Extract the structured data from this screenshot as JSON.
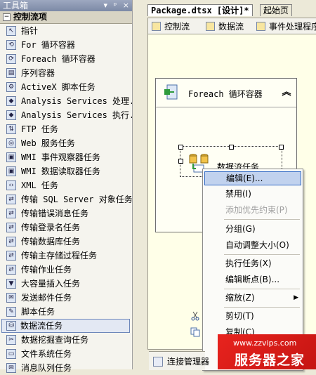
{
  "toolbox": {
    "title": "工具箱",
    "title_buttons": [
      "▾",
      "ᵖ",
      "×"
    ],
    "section": "控制流项",
    "section_toggle": "−",
    "items": [
      {
        "label": "指针",
        "icon": "pointer-icon",
        "glyph": "↖"
      },
      {
        "label": "For 循环容器",
        "icon": "for-loop-icon",
        "glyph": "⟲"
      },
      {
        "label": "Foreach 循环容器",
        "icon": "foreach-loop-icon",
        "glyph": "⟳"
      },
      {
        "label": "序列容器",
        "icon": "sequence-container-icon",
        "glyph": "▤"
      },
      {
        "label": "ActiveX 脚本任务",
        "icon": "activex-script-icon",
        "glyph": "⚙"
      },
      {
        "label": "Analysis Services 处理...",
        "icon": "analysis-processing-icon",
        "glyph": "◆"
      },
      {
        "label": "Analysis Services 执行...",
        "icon": "analysis-execute-icon",
        "glyph": "◆"
      },
      {
        "label": "FTP 任务",
        "icon": "ftp-icon",
        "glyph": "⇅"
      },
      {
        "label": "Web 服务任务",
        "icon": "web-service-icon",
        "glyph": "◎"
      },
      {
        "label": "WMI 事件观察器任务",
        "icon": "wmi-event-icon",
        "glyph": "▣"
      },
      {
        "label": "WMI 数据读取器任务",
        "icon": "wmi-reader-icon",
        "glyph": "▣"
      },
      {
        "label": "XML 任务",
        "icon": "xml-icon",
        "glyph": "‹›"
      },
      {
        "label": "传输 SQL Server 对象任务",
        "icon": "transfer-objects-icon",
        "glyph": "⇄"
      },
      {
        "label": "传输错误消息任务",
        "icon": "transfer-errors-icon",
        "glyph": "⇄"
      },
      {
        "label": "传输登录名任务",
        "icon": "transfer-logins-icon",
        "glyph": "⇄"
      },
      {
        "label": "传输数据库任务",
        "icon": "transfer-database-icon",
        "glyph": "⇄"
      },
      {
        "label": "传输主存储过程任务",
        "icon": "transfer-procs-icon",
        "glyph": "⇄"
      },
      {
        "label": "传输作业任务",
        "icon": "transfer-jobs-icon",
        "glyph": "⇄"
      },
      {
        "label": "大容量插入任务",
        "icon": "bulk-insert-icon",
        "glyph": "▼"
      },
      {
        "label": "发送邮件任务",
        "icon": "send-mail-icon",
        "glyph": "✉"
      },
      {
        "label": "脚本任务",
        "icon": "script-icon",
        "glyph": "✎"
      },
      {
        "label": "数据流任务",
        "icon": "data-flow-icon",
        "glyph": "⛁",
        "selected": true
      },
      {
        "label": "数据挖掘查询任务",
        "icon": "data-mining-icon",
        "glyph": "✂"
      },
      {
        "label": "文件系统任务",
        "icon": "file-system-icon",
        "glyph": "▭"
      },
      {
        "label": "消息队列任务",
        "icon": "message-queue-icon",
        "glyph": "✉"
      }
    ]
  },
  "designer": {
    "doc_tabs": [
      "Package.dtsx [设计]*",
      "起始页"
    ],
    "sub_tabs": [
      "控制流",
      "数据流",
      "事件处理程序"
    ],
    "foreach_label": "Foreach 循环容器",
    "foreach_toggle": "≈",
    "task_label": "数据流任务",
    "connection_tab": "连接管理器"
  },
  "context_menu": {
    "items": [
      {
        "label": "编辑(E)...",
        "highlight": true
      },
      {
        "label": "禁用(I)"
      },
      {
        "label": "添加优先约束(P)",
        "disabled": true
      },
      {
        "label": "分组(G)"
      },
      {
        "label": "自动调整大小(O)"
      },
      {
        "label": "执行任务(X)"
      },
      {
        "label": "编辑断点(B)..."
      },
      {
        "label": "缩放(Z)",
        "submenu": true
      },
      {
        "label": "剪切(T)",
        "icon": "cut-icon"
      },
      {
        "label": "复制(C)",
        "icon": "copy-icon"
      }
    ]
  },
  "watermark": {
    "url": "www.zzvips.com",
    "name": "服务器之家"
  },
  "colors": {
    "highlight": "#316AC5",
    "canvas": "#FFFFE8",
    "watermark": "#D41B17"
  }
}
